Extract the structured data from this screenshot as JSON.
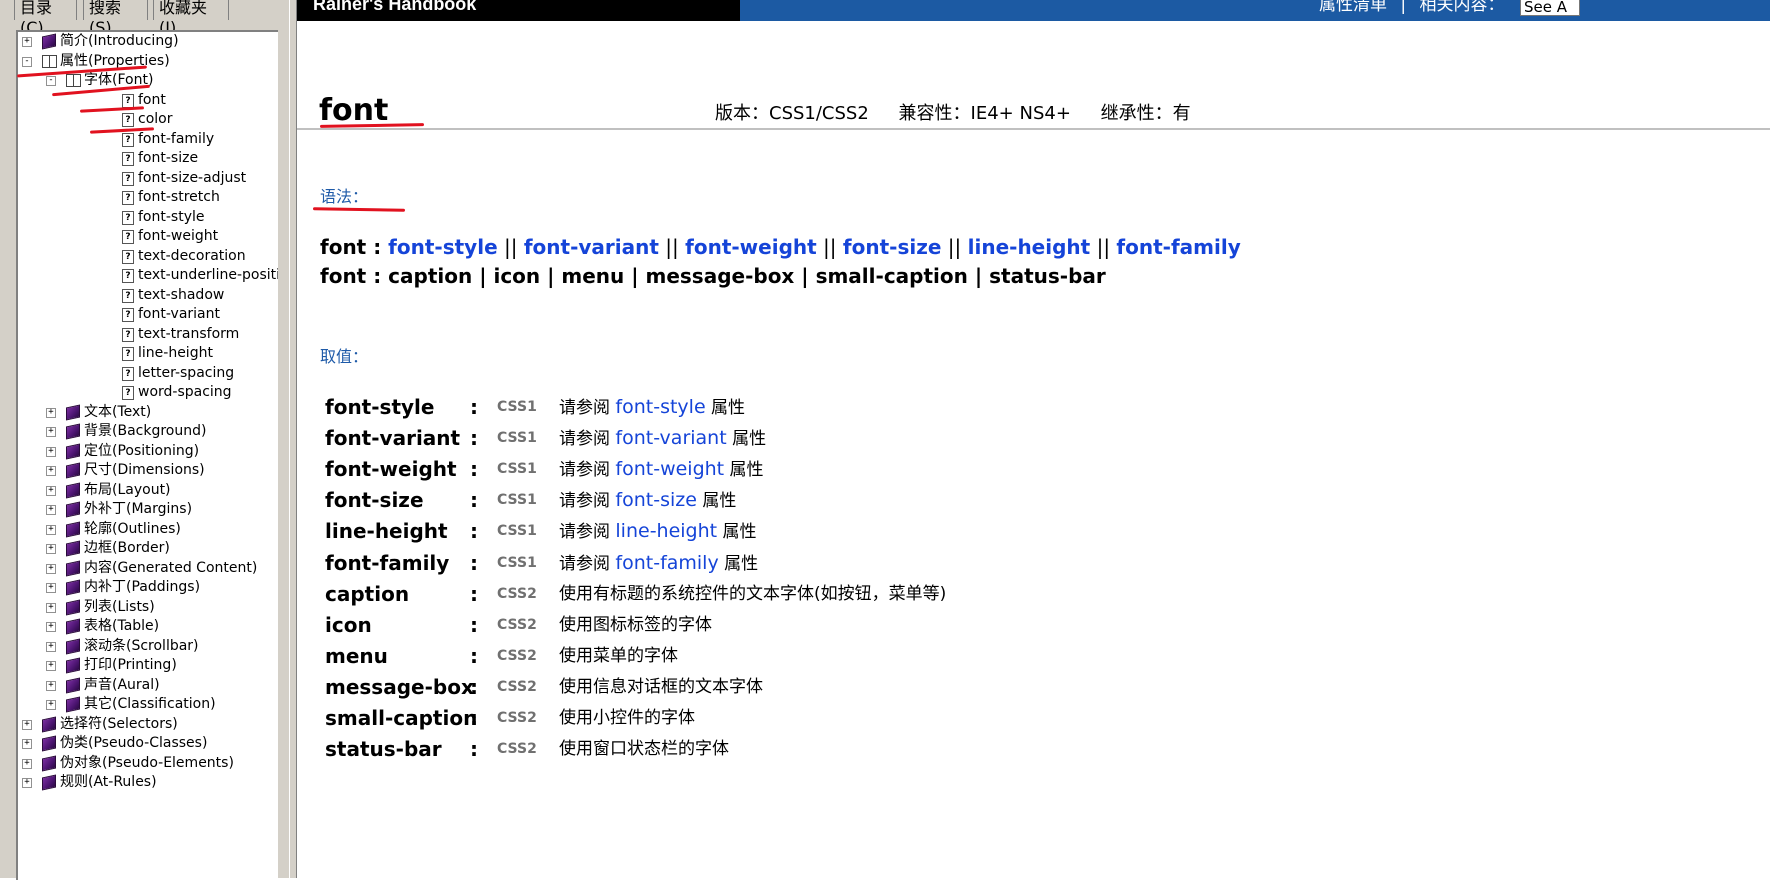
{
  "tabs": [
    {
      "label": "目录(C)"
    },
    {
      "label": "搜索(S)"
    },
    {
      "label": "收藏夹(I)"
    }
  ],
  "tree": [
    {
      "label": "简介(Introducing)",
      "expander": "+",
      "icon": "book"
    },
    {
      "label": "属性(Properties)",
      "expander": "-",
      "icon": "book-open"
    },
    {
      "label": "字体(Font)",
      "expander": "-",
      "icon": "book-open"
    },
    {
      "label": "font",
      "icon": "page"
    },
    {
      "label": "color",
      "icon": "page"
    },
    {
      "label": "font-family",
      "icon": "page"
    },
    {
      "label": "font-size",
      "icon": "page"
    },
    {
      "label": "font-size-adjust",
      "icon": "page"
    },
    {
      "label": "font-stretch",
      "icon": "page"
    },
    {
      "label": "font-style",
      "icon": "page"
    },
    {
      "label": "font-weight",
      "icon": "page"
    },
    {
      "label": "text-decoration",
      "icon": "page"
    },
    {
      "label": "text-underline-position",
      "icon": "page"
    },
    {
      "label": "text-shadow",
      "icon": "page"
    },
    {
      "label": "font-variant",
      "icon": "page"
    },
    {
      "label": "text-transform",
      "icon": "page"
    },
    {
      "label": "line-height",
      "icon": "page"
    },
    {
      "label": "letter-spacing",
      "icon": "page"
    },
    {
      "label": "word-spacing",
      "icon": "page"
    },
    {
      "label": "文本(Text)",
      "expander": "+",
      "icon": "book"
    },
    {
      "label": "背景(Background)",
      "expander": "+",
      "icon": "book"
    },
    {
      "label": "定位(Positioning)",
      "expander": "+",
      "icon": "book"
    },
    {
      "label": "尺寸(Dimensions)",
      "expander": "+",
      "icon": "book"
    },
    {
      "label": "布局(Layout)",
      "expander": "+",
      "icon": "book"
    },
    {
      "label": "外补丁(Margins)",
      "expander": "+",
      "icon": "book"
    },
    {
      "label": "轮廓(Outlines)",
      "expander": "+",
      "icon": "book"
    },
    {
      "label": "边框(Border)",
      "expander": "+",
      "icon": "book"
    },
    {
      "label": "内容(Generated Content)",
      "expander": "+",
      "icon": "book"
    },
    {
      "label": "内补丁(Paddings)",
      "expander": "+",
      "icon": "book"
    },
    {
      "label": "列表(Lists)",
      "expander": "+",
      "icon": "book"
    },
    {
      "label": "表格(Table)",
      "expander": "+",
      "icon": "book"
    },
    {
      "label": "滚动条(Scrollbar)",
      "expander": "+",
      "icon": "book"
    },
    {
      "label": "打印(Printing)",
      "expander": "+",
      "icon": "book"
    },
    {
      "label": "声音(Aural)",
      "expander": "+",
      "icon": "book"
    },
    {
      "label": "其它(Classification)",
      "expander": "+",
      "icon": "book"
    },
    {
      "label": "选择符(Selectors)",
      "expander": "+",
      "icon": "book"
    },
    {
      "label": "伪类(Pseudo-Classes)",
      "expander": "+",
      "icon": "book"
    },
    {
      "label": "伪对象(Pseudo-Elements)",
      "expander": "+",
      "icon": "book"
    },
    {
      "label": "规则(At-Rules)",
      "expander": "+",
      "icon": "book"
    }
  ],
  "header": {
    "title": "Rainer's Handbook",
    "nav_properties": "属性清单",
    "nav_separator": "|",
    "nav_related": "相关内容：",
    "search_value": "See A"
  },
  "content": {
    "property_title": "font",
    "version": "版本：CSS1/CSS2",
    "compat": "兼容性：IE4+ NS4+",
    "inherit": "继承性：有",
    "syntax_heading": "语法：",
    "values_heading": "取值：",
    "syntax_line1": {
      "prefix": "font : ",
      "items": [
        "font-style",
        "font-variant",
        "font-weight",
        "font-size",
        "line-height",
        "font-family"
      ],
      "separator": " || "
    },
    "syntax_line2": "font : caption | icon | menu | message-box | small-caption | status-bar",
    "values": [
      {
        "name": "font-style",
        "version": "CSS1",
        "pre": "请参阅 ",
        "link": "font-style",
        "post": " 属性"
      },
      {
        "name": "font-variant",
        "version": "CSS1",
        "pre": "请参阅 ",
        "link": "font-variant",
        "post": " 属性"
      },
      {
        "name": "font-weight",
        "version": "CSS1",
        "pre": "请参阅 ",
        "link": "font-weight",
        "post": " 属性"
      },
      {
        "name": "font-size",
        "version": "CSS1",
        "pre": "请参阅 ",
        "link": "font-size",
        "post": " 属性"
      },
      {
        "name": "line-height",
        "version": "CSS1",
        "pre": "请参阅 ",
        "link": "line-height",
        "post": " 属性"
      },
      {
        "name": "font-family",
        "version": "CSS1",
        "pre": "请参阅 ",
        "link": "font-family",
        "post": " 属性"
      },
      {
        "name": "caption",
        "version": "CSS2",
        "pre": "使用有标题的系统控件的文本字体(如按钮，菜单等)",
        "link": "",
        "post": ""
      },
      {
        "name": "icon",
        "version": "CSS2",
        "pre": "使用图标标签的字体",
        "link": "",
        "post": ""
      },
      {
        "name": "menu",
        "version": "CSS2",
        "pre": "使用菜单的字体",
        "link": "",
        "post": ""
      },
      {
        "name": "message-box",
        "version": "CSS2",
        "pre": "使用信息对话框的文本字体",
        "link": "",
        "post": ""
      },
      {
        "name": "small-caption",
        "version": "CSS2",
        "pre": "使用小控件的字体",
        "link": "",
        "post": ""
      },
      {
        "name": "status-bar",
        "version": "CSS2",
        "pre": "使用窗口状态栏的字体",
        "link": "",
        "post": ""
      }
    ],
    "colon": ":"
  },
  "colors": {
    "link": "#1544d8",
    "section_heading": "#1e5aa8",
    "header_blue": "#1c5aa3",
    "annotation_red": "#e1121f",
    "version_gray": "#707070"
  }
}
